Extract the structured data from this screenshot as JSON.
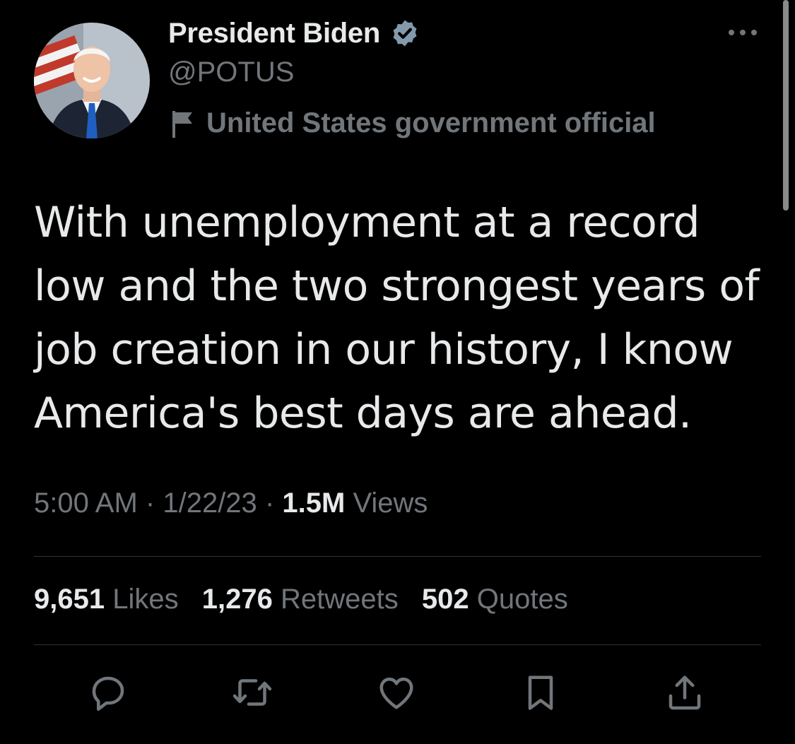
{
  "author": {
    "display_name": "President Biden",
    "handle": "@POTUS",
    "label": "United States government official",
    "verified_color": "#829aab"
  },
  "tweet": {
    "text": "With unemployment at a record low and the two strongest years of job creation in our history, I know America's best days are ahead.",
    "time": "5:00 AM",
    "date": "1/22/23",
    "views_count": "1.5M",
    "views_label": "Views",
    "separator": "·"
  },
  "stats": {
    "likes_count": "9,651",
    "likes_label": "Likes",
    "retweets_count": "1,276",
    "retweets_label": "Retweets",
    "quotes_count": "502",
    "quotes_label": "Quotes"
  },
  "actions": [
    "reply-icon",
    "retweet-icon",
    "like-icon",
    "bookmark-icon",
    "share-icon"
  ],
  "colors": {
    "background": "#000000",
    "text": "#e7e9ea",
    "secondary": "#71767b",
    "divider": "#2f3336"
  }
}
